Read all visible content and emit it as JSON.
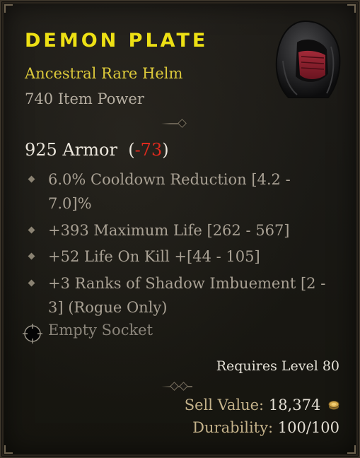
{
  "item": {
    "name": "Demon Plate",
    "type": "Ancestral Rare Helm",
    "power": "740 Item Power",
    "icon": "helm-icon"
  },
  "armor": {
    "value": "925 Armor",
    "open": "(",
    "delta": "-73",
    "close": ")"
  },
  "affixes": [
    "6.0% Cooldown Reduction [4.2 - 7.0]%",
    "+393 Maximum Life [262 - 567]",
    "+52 Life On Kill +[44 - 105]",
    "+3 Ranks of Shadow Imbuement [2 - 3] (Rogue Only)"
  ],
  "socket": {
    "label": "Empty Socket",
    "icon": "socket-icon"
  },
  "requirement": "Requires Level 80",
  "sell": {
    "label": "Sell Value:",
    "value": "18,374",
    "icon": "gold-coin-icon"
  },
  "durability": {
    "label": "Durability:",
    "value": "100/100"
  },
  "colors": {
    "name": "#ede014",
    "type": "#dcc93a",
    "delta_negative": "#e02a1e"
  }
}
